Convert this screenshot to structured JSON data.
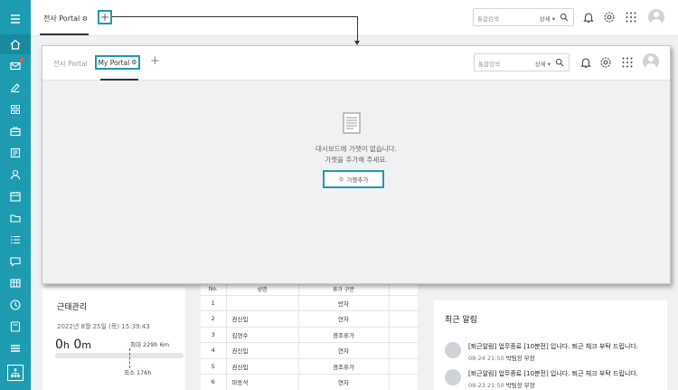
{
  "topbar": {
    "tab_label": "전사 Portal",
    "add_symbol": "+",
    "search": {
      "placeholder": "통합검색",
      "option": "상세"
    }
  },
  "overlay": {
    "tabs": [
      {
        "label": "전사 Portal"
      },
      {
        "label": "My Portal"
      }
    ],
    "add_symbol": "+",
    "search": {
      "placeholder": "통합검색",
      "option": "상세"
    },
    "empty_message": [
      "대시보드에 가젯이 없습니다.",
      "가젯을 추가해 주세요."
    ],
    "add_gadget_label": "가젯추가"
  },
  "sidebar": {
    "items": [
      {
        "icon": "home-icon"
      },
      {
        "icon": "mail-icon",
        "badge": true
      },
      {
        "icon": "edit-icon"
      },
      {
        "icon": "grid-icon"
      },
      {
        "icon": "briefcase-icon"
      },
      {
        "icon": "form-icon"
      },
      {
        "icon": "person-icon"
      },
      {
        "icon": "calendar-icon"
      },
      {
        "icon": "folder-icon"
      },
      {
        "icon": "list-icon"
      },
      {
        "icon": "chat-icon"
      },
      {
        "icon": "table-icon"
      },
      {
        "icon": "clock-icon"
      },
      {
        "icon": "device-icon"
      },
      {
        "icon": "stack-icon"
      },
      {
        "icon": "org-chart-icon"
      }
    ]
  },
  "attendance": {
    "title": "근태관리",
    "date": "2022년 8월 25일 (목) 15:39:43",
    "time_hours": "0",
    "time_minutes": "0",
    "hour_unit": "h",
    "minute_unit": "m",
    "max_label": "최대 229h 6m",
    "min_label": "최소 176h"
  },
  "vacation_table": {
    "headers": [
      "No.",
      "성명",
      "휴가 구분",
      ""
    ],
    "rows": [
      {
        "no": "1",
        "name": "",
        "type": "반차"
      },
      {
        "no": "2",
        "name": "권신입",
        "type": "연차"
      },
      {
        "no": "3",
        "name": "김연수",
        "type": "경조휴가"
      },
      {
        "no": "4",
        "name": "권신입",
        "type": "연차"
      },
      {
        "no": "5",
        "name": "권신입",
        "type": "경조휴가"
      },
      {
        "no": "6",
        "name": "마동석",
        "type": "연차"
      }
    ]
  },
  "notifications": {
    "title": "최근 알림",
    "items": [
      {
        "text": "[퇴근알림] 업무종료 [10분전] 입니다. 퇴근 체크 부탁 드립니다.",
        "time": "08-24 21:50",
        "sender": "박팀장 부장"
      },
      {
        "text": "[퇴근알림] 업무종료 [10분전] 입니다. 퇴근 체크 부탁 드립니다.",
        "time": "08-23 21:50",
        "sender": "박팀장 부장"
      }
    ]
  },
  "colors": {
    "accent": "#1e9bb0",
    "sidebar": "#1e9bb0"
  }
}
